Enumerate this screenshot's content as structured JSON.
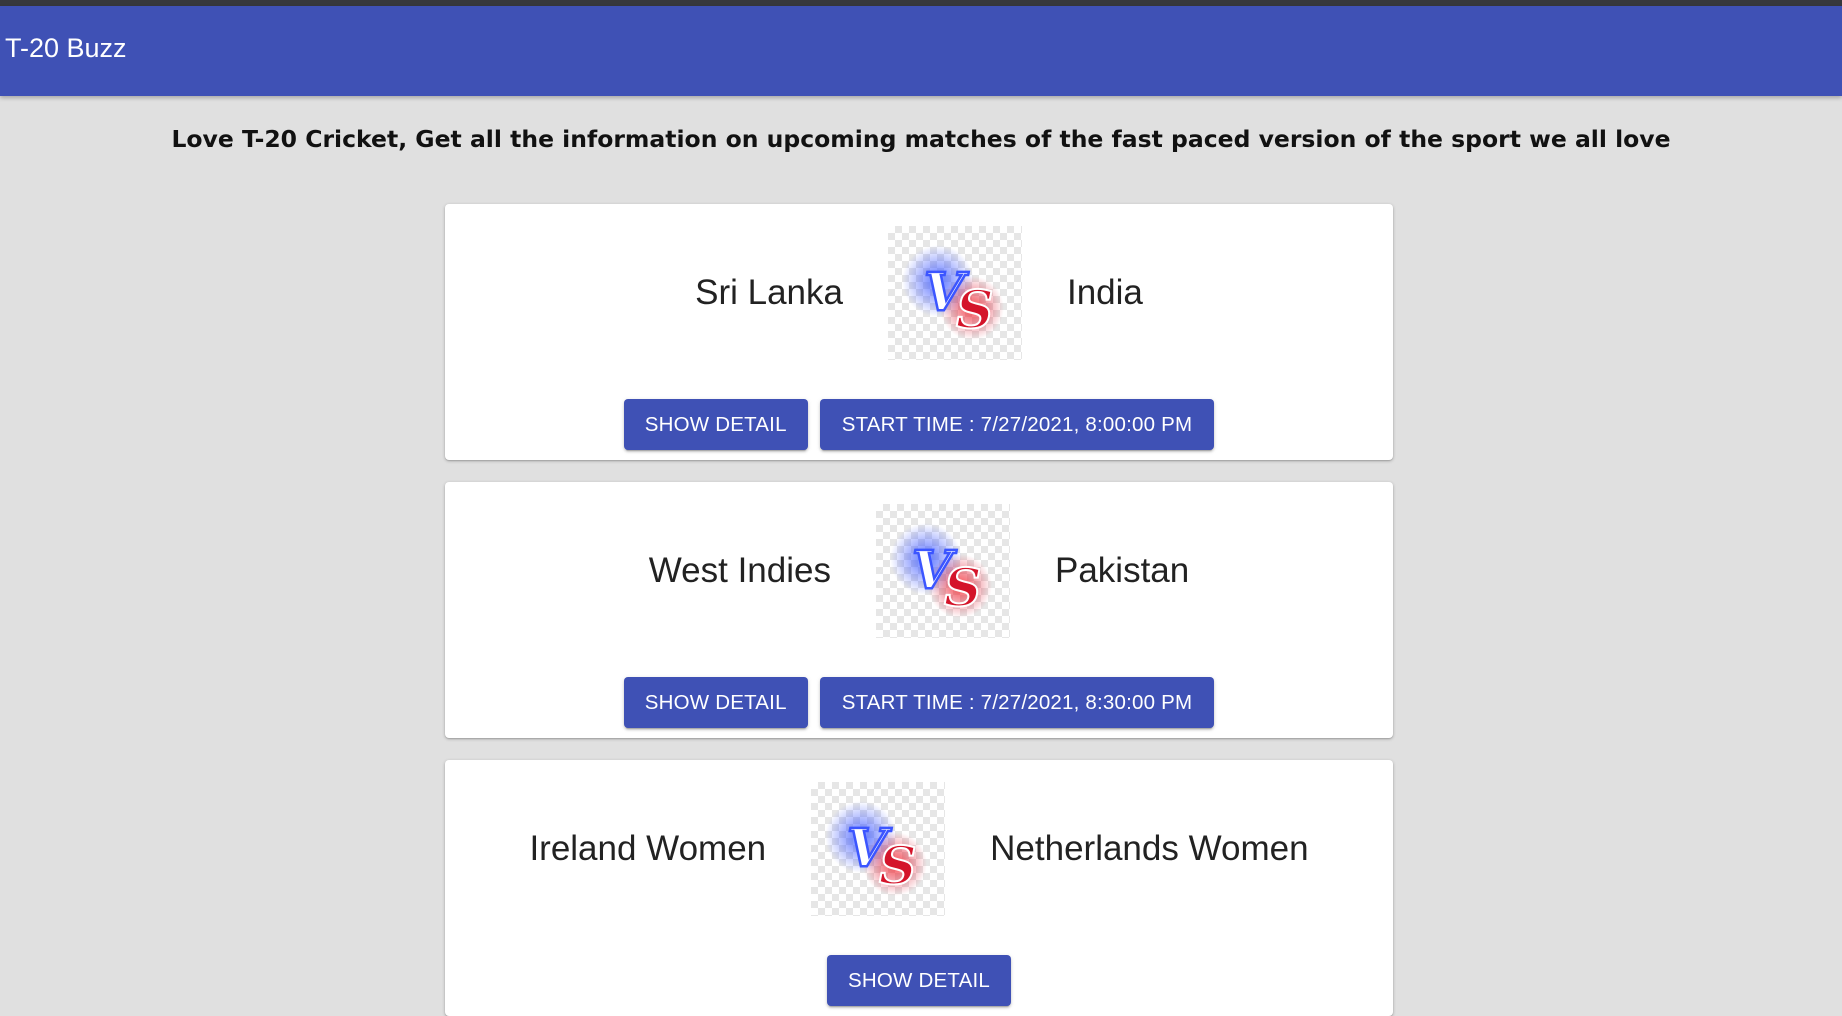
{
  "app": {
    "title": "T-20 Buzz",
    "tagline": "Love T-20 Cricket, Get all the information on upcoming matches of the fast paced version of the sport we all love"
  },
  "colors": {
    "primary": "#3f51b5",
    "background": "#e0e0e0",
    "card": "#ffffff"
  },
  "matches": [
    {
      "team1": "Sri Lanka",
      "team2": "India",
      "vs_icon": "vs-icon",
      "detail_label": "SHOW DETAIL",
      "start_label": "START TIME : 7/27/2021, 8:00:00 PM"
    },
    {
      "team1": "West Indies",
      "team2": "Pakistan",
      "vs_icon": "vs-icon",
      "detail_label": "SHOW DETAIL",
      "start_label": "START TIME : 7/27/2021, 8:30:00 PM"
    },
    {
      "team1": "Ireland Women",
      "team2": "Netherlands Women",
      "vs_icon": "vs-icon",
      "detail_label": "SHOW DETAIL",
      "start_label": ""
    }
  ]
}
